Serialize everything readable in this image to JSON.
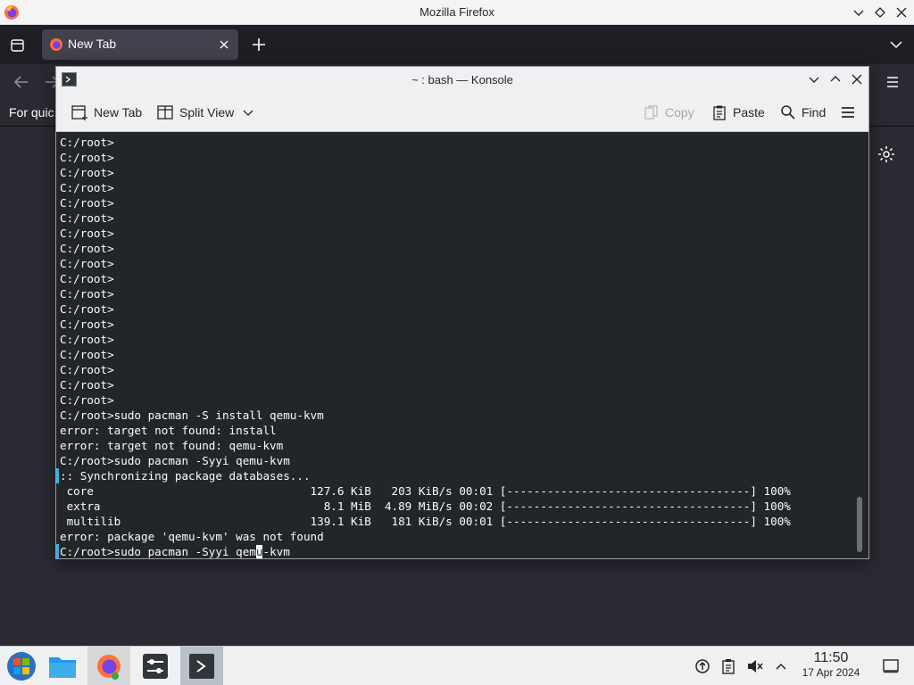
{
  "firefox": {
    "window_title": "Mozilla Firefox",
    "tab_label": "New Tab",
    "bookmarks_hint": "For quic"
  },
  "konsole": {
    "window_title": "~ : bash — Konsole",
    "toolbar": {
      "new_tab": "New Tab",
      "split_view": "Split View",
      "copy": "Copy",
      "paste": "Paste",
      "find": "Find"
    },
    "lines": [
      "C:/root>",
      "C:/root>",
      "C:/root>",
      "C:/root>",
      "C:/root>",
      "C:/root>",
      "C:/root>",
      "C:/root>",
      "C:/root>",
      "C:/root>",
      "C:/root>",
      "C:/root>",
      "C:/root>",
      "C:/root>",
      "C:/root>",
      "C:/root>",
      "C:/root>",
      "C:/root>",
      "C:/root>sudo pacman -S install qemu-kvm",
      "error: target not found: install",
      "error: target not found: qemu-kvm",
      "C:/root>sudo pacman -Syyi qemu-kvm",
      ":: Synchronizing package databases...",
      " core                                127.6 KiB   203 KiB/s 00:01 [------------------------------------] 100%",
      " extra                                 8.1 MiB  4.89 MiB/s 00:02 [------------------------------------] 100%",
      " multilib                            139.1 KiB   181 KiB/s 00:01 [------------------------------------] 100%",
      "error: package 'qemu-kvm' was not found"
    ],
    "prompt_line": {
      "before_cursor": "C:/root>sudo pacman -Syyi qem",
      "cursor_char": "u",
      "after_cursor": "-kvm"
    }
  },
  "taskbar": {
    "time": "11:50",
    "date": "17 Apr 2024"
  },
  "colors": {
    "terminal_bg": "#232629",
    "terminal_fg": "#fcfcfc",
    "accent": "#3daee9",
    "firefox_dark": "#2b2a33"
  }
}
